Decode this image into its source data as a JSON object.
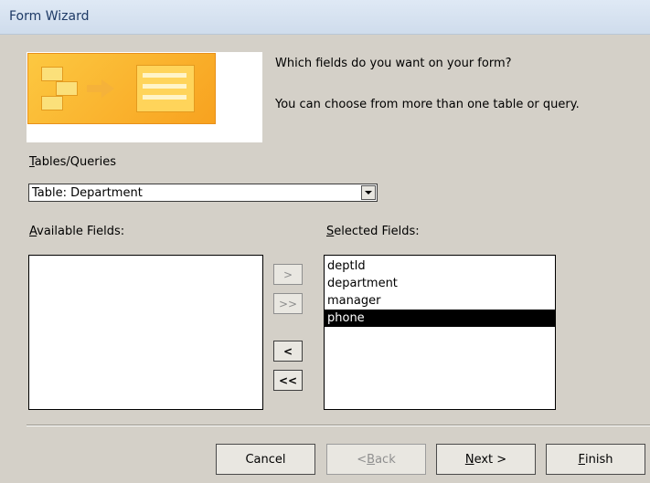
{
  "window": {
    "title": "Form Wizard"
  },
  "intro": {
    "question": "Which fields do you want on your form?",
    "hint": "You can choose from more than one table or query."
  },
  "illustration": {
    "icon": "form-wizard-illustration"
  },
  "tables_queries": {
    "label_mnemonic": "T",
    "label_rest": "ables/Queries",
    "selected": "Table: Department"
  },
  "available_fields": {
    "label_mnemonic": "A",
    "label_rest": "vailable Fields:",
    "items": []
  },
  "selected_fields": {
    "label_mnemonic": "S",
    "label_rest": "elected Fields:",
    "items": [
      "deptId",
      "department",
      "manager",
      "phone"
    ],
    "highlighted_index": 3
  },
  "move_buttons": {
    "add_one": ">",
    "add_all": ">>",
    "remove_one": "<",
    "remove_all": "<<"
  },
  "footer": {
    "cancel": "Cancel",
    "back_mnemonic": "B",
    "back_prefix": "< ",
    "back_rest": "ack",
    "next_mnemonic": "N",
    "next_rest": "ext >",
    "finish_mnemonic": "F",
    "finish_rest": "inish"
  },
  "colors": {
    "dialog_bg": "#d4d0c8",
    "selection_bg": "#000000",
    "title_text": "#1e3a66"
  }
}
